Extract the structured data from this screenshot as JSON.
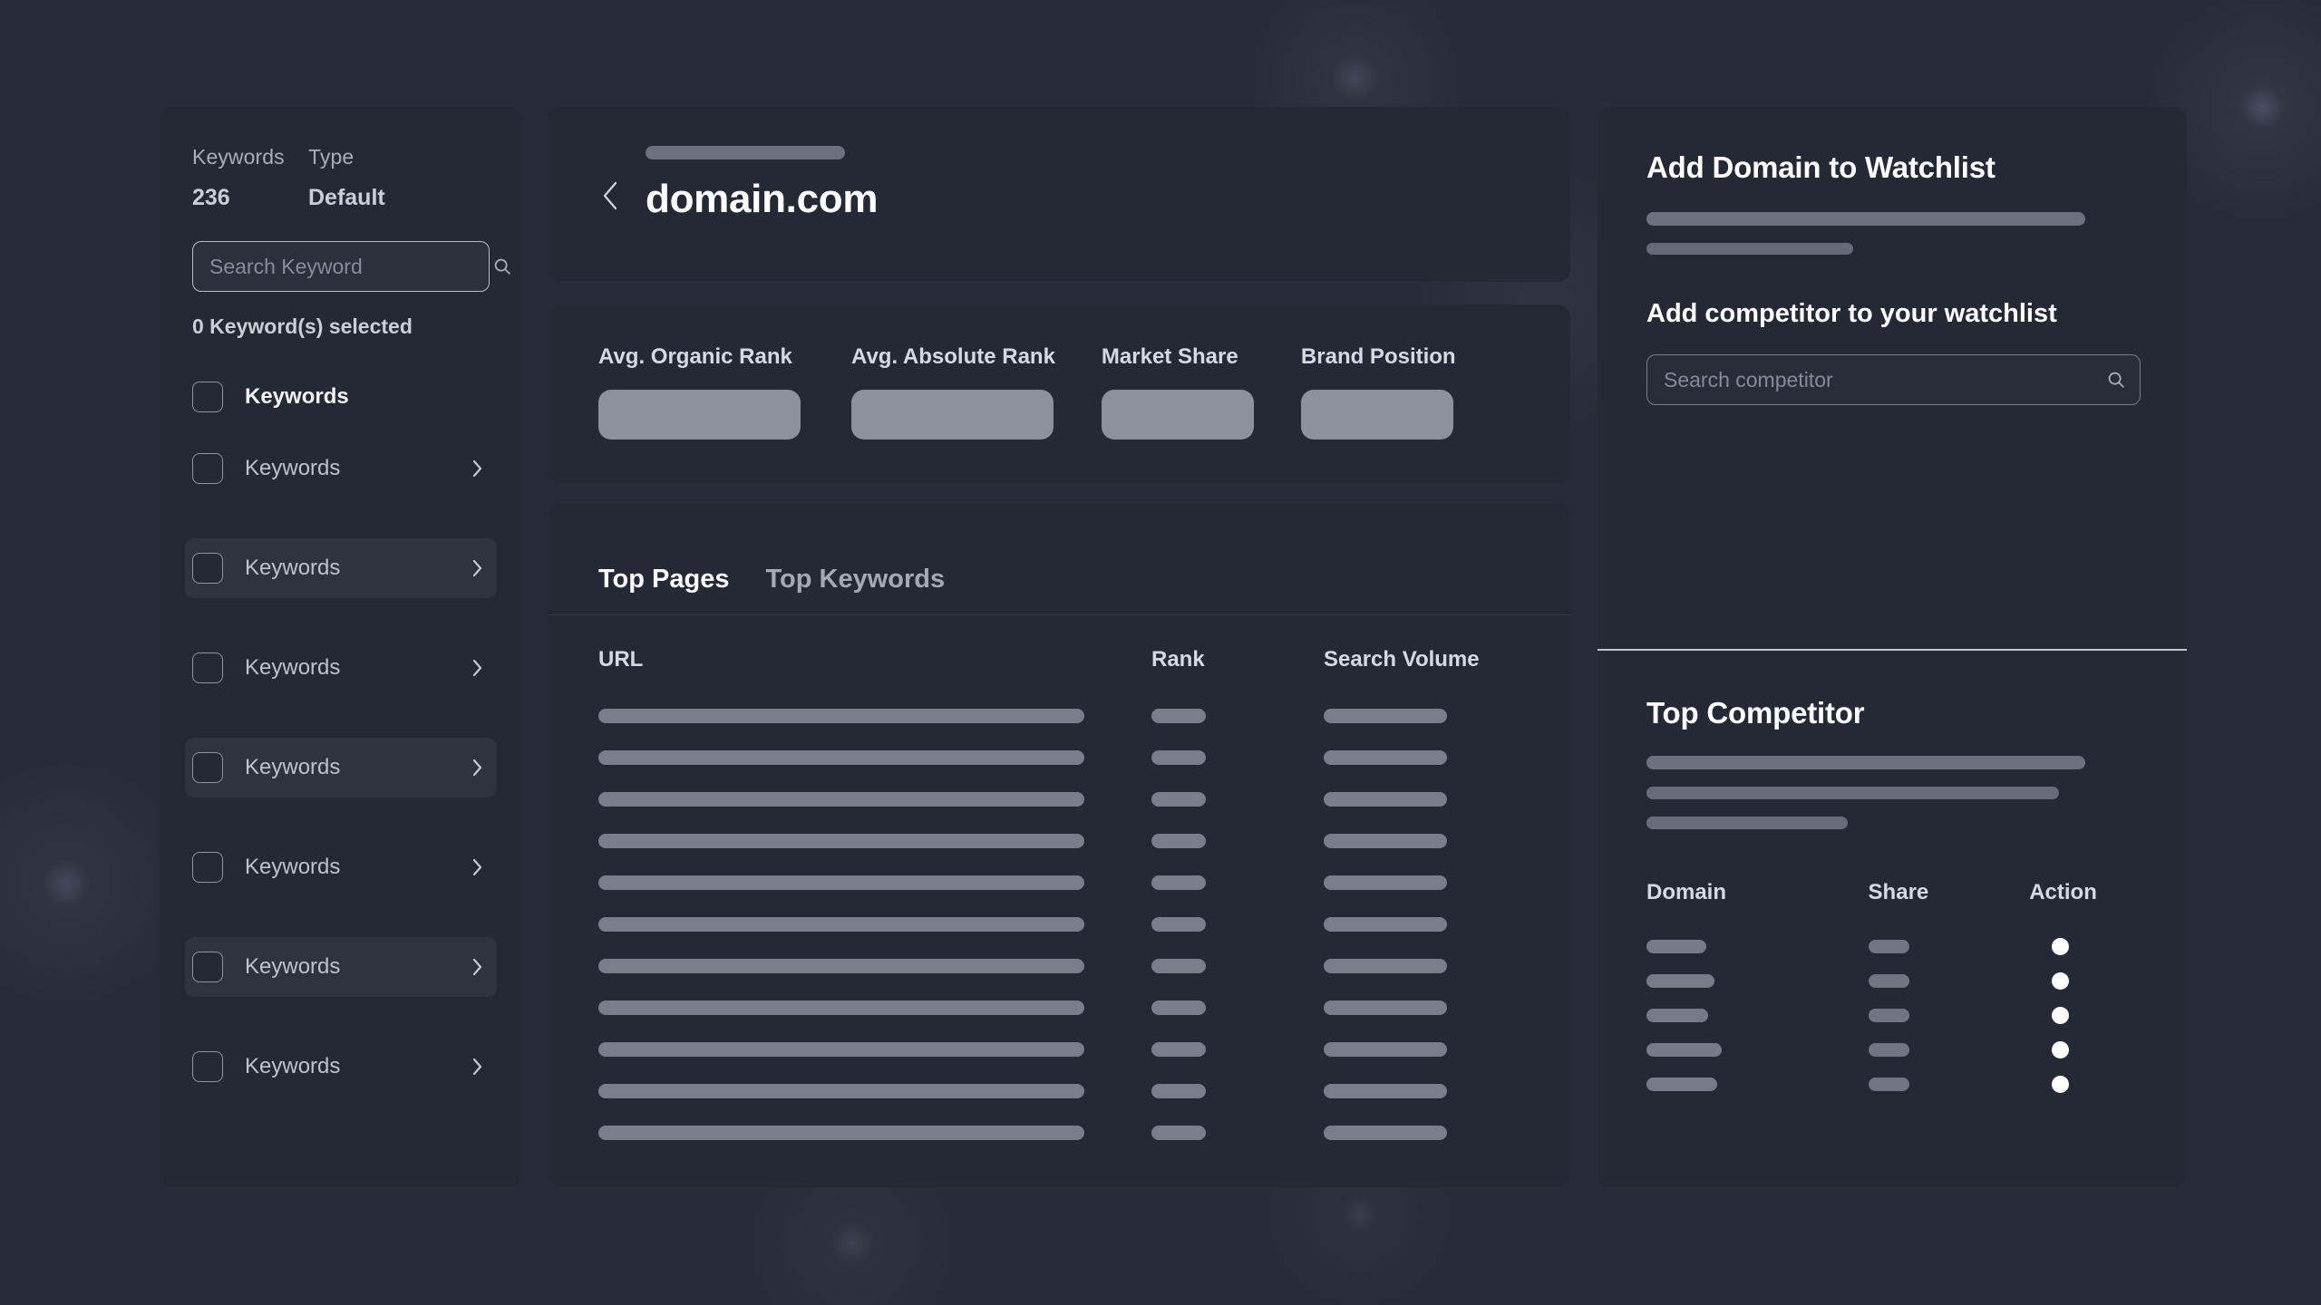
{
  "theme": {
    "page_bg": "#262c39",
    "card_bg": "#242a35",
    "row_highlight": "#2d3440",
    "skeleton": "#787f8c",
    "text_primary": "#ffffff",
    "text_secondary": "#a7aeba",
    "accent_white": "#ffffff",
    "divider": "#c2c8d2"
  },
  "sidebar": {
    "stats": [
      {
        "label": "Keywords",
        "value": "236"
      },
      {
        "label": "Type",
        "value": "Default"
      }
    ],
    "search": {
      "placeholder": "Search Keyword",
      "value": "",
      "icon": "search-icon"
    },
    "selected_count_text": "0 Keyword(s) selected",
    "list_header_label": "Keywords",
    "rows": [
      {
        "label": "Keywords",
        "highlighted": false,
        "chevron": "chevron-right-icon"
      },
      {
        "label": "Keywords",
        "highlighted": true,
        "chevron": "chevron-right-icon"
      },
      {
        "label": "Keywords",
        "highlighted": false,
        "chevron": "chevron-right-icon"
      },
      {
        "label": "Keywords",
        "highlighted": true,
        "chevron": "chevron-right-icon"
      },
      {
        "label": "Keywords",
        "highlighted": false,
        "chevron": "chevron-right-icon"
      },
      {
        "label": "Keywords",
        "highlighted": true,
        "chevron": "chevron-right-icon"
      },
      {
        "label": "Keywords",
        "highlighted": false,
        "chevron": "chevron-right-icon"
      }
    ]
  },
  "domain_header": {
    "back_icon": "chevron-left-icon",
    "title": "domain.com"
  },
  "metrics": [
    {
      "label": "Avg. Organic Rank"
    },
    {
      "label": "Avg. Absolute Rank"
    },
    {
      "label": "Market Share"
    },
    {
      "label": "Brand Position"
    }
  ],
  "table_panel": {
    "tabs": [
      {
        "label": "Top Pages",
        "active": true
      },
      {
        "label": "Top Keywords",
        "active": false
      }
    ],
    "columns": [
      "URL",
      "Rank",
      "Search Volume"
    ],
    "row_count": 11
  },
  "watchlist": {
    "heading": "Add Domain to Watchlist",
    "subheading": "Add competitor to your watchlist",
    "competitor_search": {
      "placeholder": "Search competitor",
      "value": "",
      "icon": "search-icon"
    }
  },
  "top_competitor": {
    "heading": "Top Competitor",
    "columns": [
      "Domain",
      "Share",
      "Action"
    ],
    "rows": [
      {
        "domain_width": 66,
        "action_icon": "circle-action-icon"
      },
      {
        "domain_width": 75,
        "action_icon": "circle-action-icon"
      },
      {
        "domain_width": 68,
        "action_icon": "circle-action-icon"
      },
      {
        "domain_width": 83,
        "action_icon": "circle-action-icon"
      },
      {
        "domain_width": 78,
        "action_icon": "circle-action-icon"
      }
    ]
  }
}
